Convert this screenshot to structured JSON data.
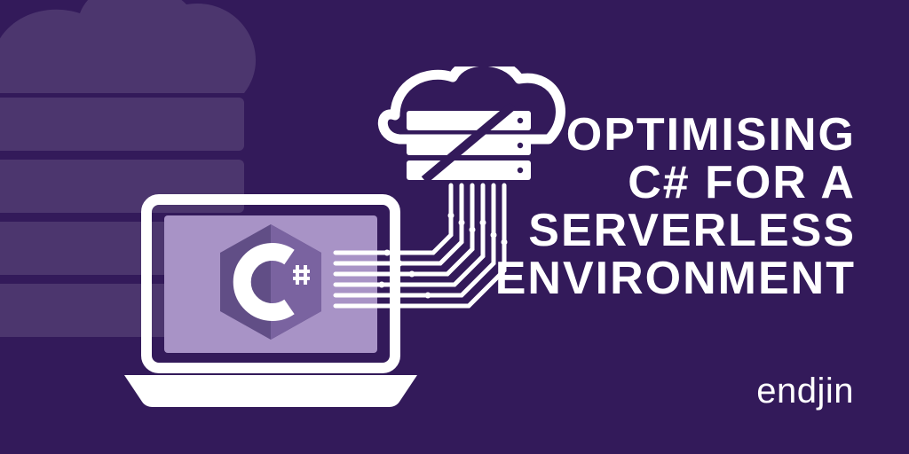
{
  "headline": {
    "line1": "OPTIMISING",
    "line2": "C# FOR A",
    "line3": "SERVERLESS",
    "line4": "ENVIRONMENT"
  },
  "brand": "endjin",
  "logo_letter": "C",
  "colors": {
    "background": "#331A5A",
    "white": "#FFFFFF",
    "lilac_light": "#A893C6",
    "lilac_mid": "#8D74B0",
    "lilac_dark": "#614E86"
  }
}
